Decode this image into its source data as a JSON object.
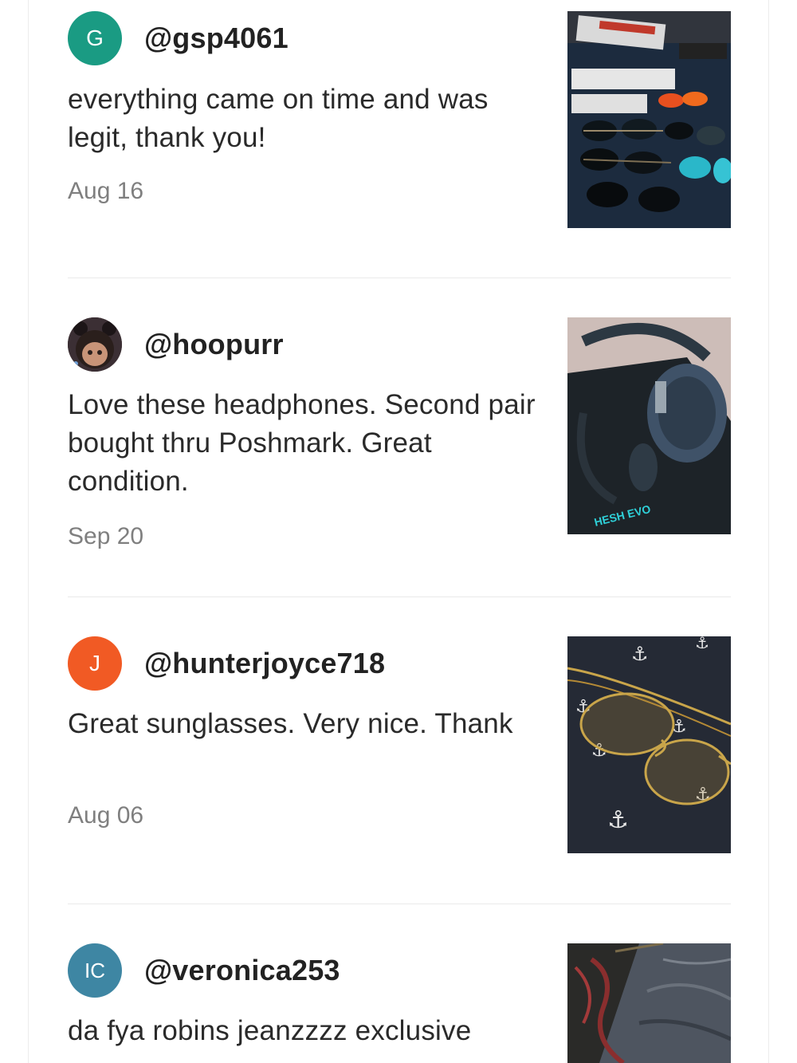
{
  "reviews": [
    {
      "avatar_initials": "G",
      "avatar_color": "#1a9b83",
      "username": "@gsp4061",
      "comment": "everything came on time and was legit, thank you!",
      "date": "Aug 16",
      "photo": "sunglasses-collection-photo"
    },
    {
      "avatar_initials": "",
      "avatar_color": "#4a3a35",
      "username": "@hoopurr",
      "comment": "Love these headphones. Second pair bought thru Poshmark. Great condition.",
      "date": "Sep 20",
      "photo": "headphones-photo",
      "photo_text": "HESH EVO"
    },
    {
      "avatar_initials": "J",
      "avatar_color": "#f15a24",
      "username": "@hunterjoyce718",
      "comment": "Great sunglasses. Very nice. Thank",
      "date": "Aug 06",
      "photo": "gold-aviator-sunglasses-photo"
    },
    {
      "avatar_initials": "IC",
      "avatar_color": "#3e86a3",
      "username": "@veronica253",
      "comment": "da fya robins jeanzzzz exclusive",
      "date": "",
      "photo": "jeans-photo"
    }
  ]
}
